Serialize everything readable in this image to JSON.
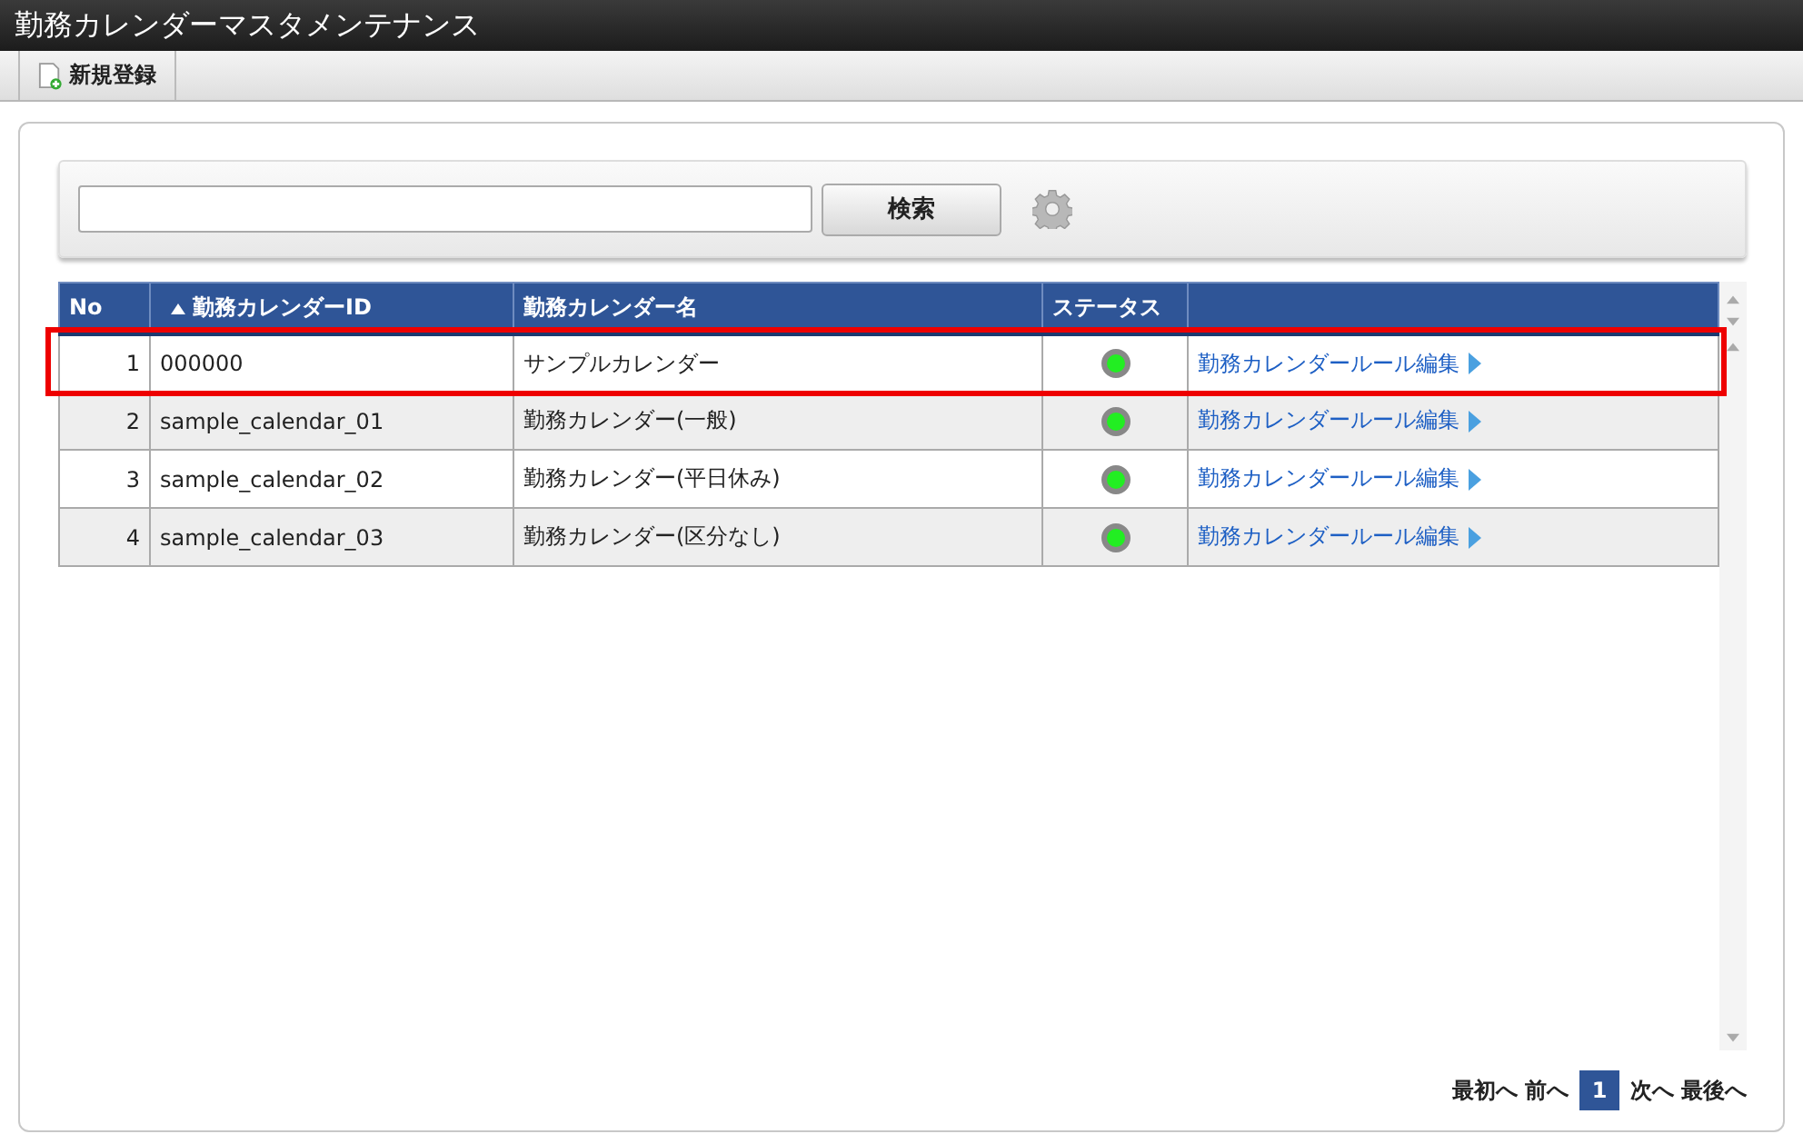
{
  "window": {
    "title": "勤務カレンダーマスタメンテナンス"
  },
  "toolbar": {
    "buttons": [
      {
        "label": "新規登録"
      }
    ]
  },
  "search": {
    "button": "検索"
  },
  "table": {
    "columns": [
      {
        "label": "No",
        "sorted": false
      },
      {
        "label": "勤務カレンダーID",
        "sorted": true
      },
      {
        "label": "勤務カレンダー名",
        "sorted": false
      },
      {
        "label": "ステータス",
        "sorted": false
      }
    ],
    "rows": [
      {
        "no": "1",
        "id": "000000",
        "name": "サンプルカレンダー",
        "color": "#22ee22",
        "link": "勤務カレンダールール編集",
        "highlighted": true
      },
      {
        "no": "2",
        "id": "sample_calendar_01",
        "name": "勤務カレンダー(一般)",
        "color": "#22ee22",
        "link": "勤務カレンダールール編集",
        "highlighted": false
      },
      {
        "no": "3",
        "id": "sample_calendar_02",
        "name": "勤務カレンダー(平日休み)",
        "color": "#22ee22",
        "link": "勤務カレンダールール編集",
        "highlighted": false
      },
      {
        "no": "4",
        "id": "sample_calendar_03",
        "name": "勤務カレンダー(区分なし)",
        "color": "#22ee22",
        "link": "勤務カレンダールール編集",
        "highlighted": false
      }
    ]
  },
  "pager": {
    "first": "最初へ",
    "prev": "前へ",
    "pages": [
      {
        "label": "1",
        "selected": true
      }
    ],
    "next": "次へ",
    "last": "最後へ"
  }
}
